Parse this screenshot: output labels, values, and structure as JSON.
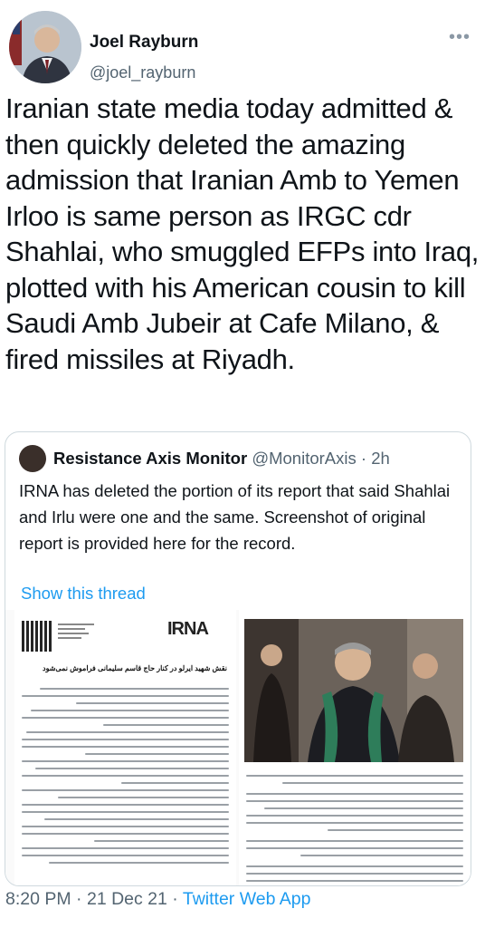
{
  "author": {
    "name": "Joel Rayburn",
    "handle": "@joel_rayburn"
  },
  "tweet": {
    "text": "Iranian state media today admitted & then quickly deleted the amazing admission that Iranian Amb to Yemen Irloo is same person as IRGC cdr Shahlai, who smuggled EFPs into Iraq, plotted with his American cousin to kill Saudi Amb Jubeir at Cafe Milano, & fired missiles at Riyadh."
  },
  "quote": {
    "name": "Resistance Axis Monitor",
    "handle": "@MonitorAxis",
    "separator": "·",
    "time": "2h",
    "text": "IRNA has deleted the portion of its report that said Shahlai and Irlu were one and the same. Screenshot of original report is provided here for the record.",
    "show_thread": "Show this thread",
    "media": {
      "logo_text": "IRNA",
      "article_title": "نقش شهید ایرلو در کنار حاج قاسم سلیمانی فراموش نمی‌شود"
    }
  },
  "footer": {
    "time": "8:20 PM",
    "sep1": "·",
    "date": "21 Dec 21",
    "sep2": "·",
    "app": "Twitter Web App"
  },
  "icons": {
    "more": "more-icon",
    "verified": "none"
  }
}
